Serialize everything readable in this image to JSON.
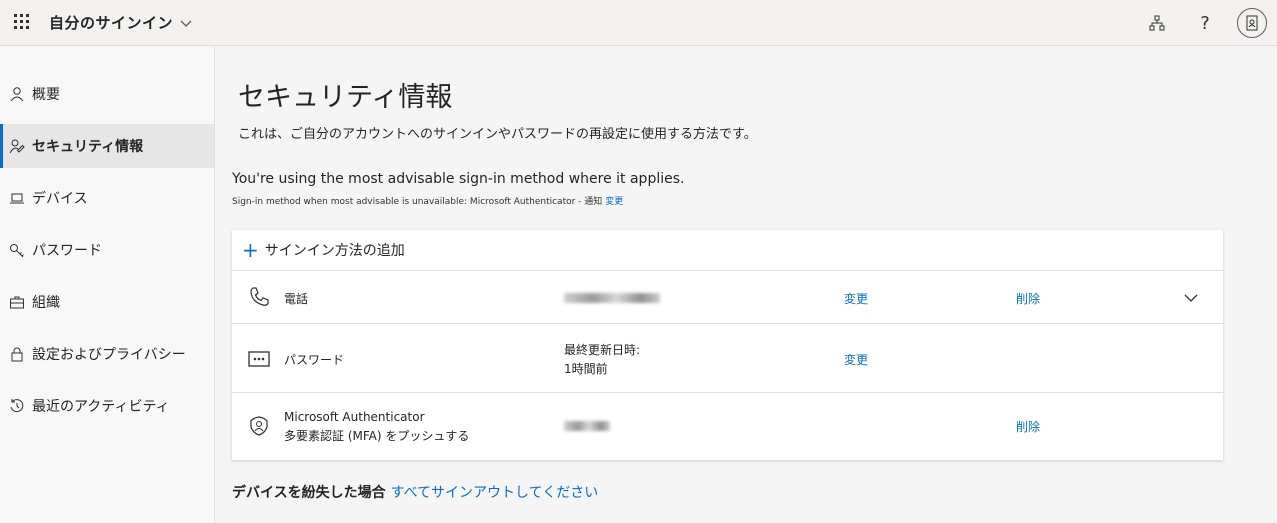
{
  "header": {
    "app_title": "自分のサインイン",
    "icons": [
      "app-launcher-icon",
      "chevron-down-icon",
      "org-chart-icon",
      "help-icon",
      "account-avatar-icon"
    ],
    "help_glyph": "?"
  },
  "sidebar": {
    "items": [
      {
        "label": "概要",
        "icon": "person-icon"
      },
      {
        "label": "セキュリティ情報",
        "icon": "security-info-icon",
        "active": true
      },
      {
        "label": "デバイス",
        "icon": "laptop-icon"
      },
      {
        "label": "パスワード",
        "icon": "key-icon"
      },
      {
        "label": "組織",
        "icon": "briefcase-icon"
      },
      {
        "label": "設定およびプライバシー",
        "icon": "lock-icon"
      },
      {
        "label": "最近のアクティビティ",
        "icon": "history-icon"
      }
    ]
  },
  "main": {
    "title": "セキュリティ情報",
    "description": "これは、ご自分のアカウントへのサインインやパスワードの再設定に使用する方法です。",
    "advisable": "You're using the most advisable sign-in method where it applies.",
    "sub_advisable": "Sign-in method when most advisable is unavailable: Microsoft Authenticator - 通知",
    "sub_advisable_link": "変更",
    "add_method": "サインイン方法の追加",
    "methods": [
      {
        "name": "電話",
        "icon": "phone-icon",
        "value": "",
        "value_redacted": true,
        "action1": "変更",
        "action2": "削除",
        "expandable": true
      },
      {
        "name": "パスワード",
        "icon": "password-dots-icon",
        "value_line1": "最終更新日時:",
        "value_line2": "1時間前",
        "action1": "変更"
      },
      {
        "name_line1": "Microsoft Authenticator",
        "name_line2": "多要素認証 (MFA) をプッシュする",
        "icon": "authenticator-icon",
        "value": "",
        "value_redacted": true,
        "action2": "削除"
      }
    ],
    "lost_device_label": "デバイスを紛失した場合",
    "lost_device_link": "すべてサインアウトしてください"
  },
  "colors": {
    "accent": "#0f6cbd",
    "background": "#f5f5f5",
    "sidebar_active": "#e6e6e6"
  }
}
